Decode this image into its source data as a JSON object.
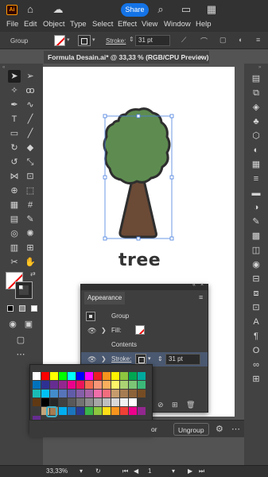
{
  "topbar": {
    "app_logo": "Ai",
    "share_label": "Share",
    "icons": [
      "home-icon",
      "cloud-icon",
      "search-icon",
      "workspace-icon",
      "panel-icon"
    ]
  },
  "menu": {
    "items": [
      "File",
      "Edit",
      "Object",
      "Type",
      "Select",
      "Effect",
      "View",
      "Window",
      "Help"
    ]
  },
  "control_bar": {
    "selection_label": "Group",
    "stroke_label": "Stroke:",
    "stroke_value": "31 pt"
  },
  "document": {
    "tab_title": "Formula Desain.ai* @ 33,33 % (RGB/CPU Preview)",
    "close_icon": "×"
  },
  "canvas": {
    "artwork_text": "tree",
    "tree_colors": {
      "foliage": "#5e8c50",
      "trunk": "#6b4a36",
      "outline": "#2e2e2e"
    }
  },
  "appearance_panel": {
    "title": "Appearance",
    "rows": {
      "group": "Group",
      "fill": "Fill:",
      "contents": "Contents",
      "stroke": "Stroke:",
      "stroke_value": "31 pt"
    }
  },
  "swatches": {
    "colors": [
      "#ffffff",
      "#ff0000",
      "#ffff00",
      "#00ff00",
      "#00ffff",
      "#0000ff",
      "#ff00ff",
      "#ed1c24",
      "#f7941d",
      "#fff200",
      "#8dc63f",
      "#00a651",
      "#00a99d",
      "#0072bc",
      "#2e3192",
      "#662d91",
      "#92278f",
      "#ec008c",
      "#ed145b",
      "#f26c4f",
      "#f69679",
      "#fbaf5d",
      "#fff568",
      "#acd373",
      "#7cc576",
      "#3bb878",
      "#1abbb4",
      "#00bff3",
      "#438ccb",
      "#5674b9",
      "#605ca8",
      "#855fa8",
      "#a763a8",
      "#f06eaa",
      "#f26d7d",
      "#c69c6d",
      "#a67c52",
      "#8c6239",
      "#754c24",
      "#603913",
      "#000000",
      "#262626",
      "#404040",
      "#595959",
      "#737373",
      "#8c8c8c",
      "#a6a6a6",
      "#bfbfbf",
      "#d9d9d9",
      "#f2f2f2",
      "#ffffff",
      "#3a3a3a",
      "#3a3a3a",
      "#c4a57a",
      "#a67c52",
      "#00aeef",
      "#1b75bc",
      "#2b3990",
      "#39b54a",
      "#8dc63f",
      "#ffde17",
      "#f7941e",
      "#ef4136",
      "#ec008c",
      "#92278f",
      "#662d91"
    ]
  },
  "bottom_bar": {
    "partial_button": "or",
    "ungroup_label": "Ungroup"
  },
  "status_bar": {
    "zoom": "33,33%",
    "artboard_number": "1"
  }
}
